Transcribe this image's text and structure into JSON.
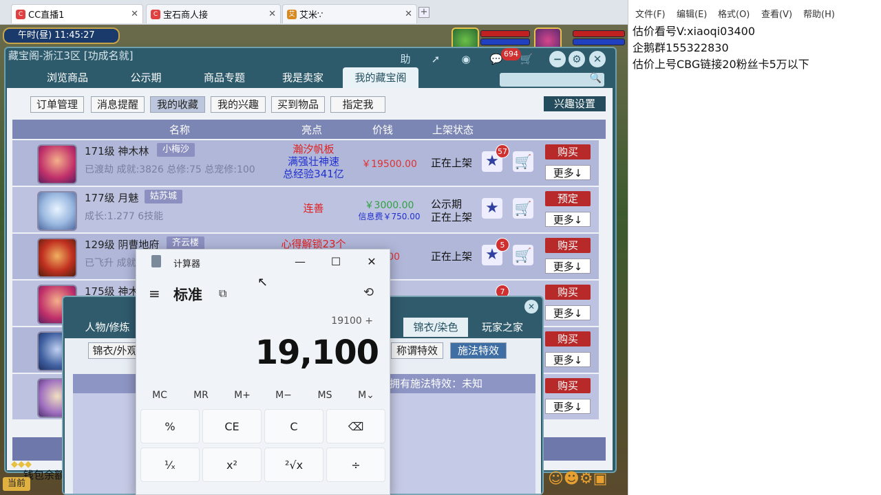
{
  "browser": {
    "tabs": [
      {
        "label": "CC直播1",
        "close": "✕"
      },
      {
        "label": "宝石商人接",
        "close": "✕"
      },
      {
        "label": "艾米∵",
        "close": "✕"
      }
    ],
    "new_tab": "+"
  },
  "game": {
    "time_label": "午时(昼)  11:45:27",
    "window_title": "藏宝阁-浙江3区 [功成名就]",
    "help_label": "助",
    "message_count": "694",
    "main_tabs": [
      "浏览商品",
      "公示期",
      "商品专题",
      "我是卖家",
      "我的藏宝阁"
    ],
    "sub_tabs": [
      "订单管理",
      "消息提醒",
      "我的收藏",
      "我的兴趣",
      "买到物品",
      "指定我"
    ],
    "interest_settings": "兴趣设置",
    "columns": [
      "名称",
      "亮点",
      "价钱",
      "上架状态"
    ],
    "rows": [
      {
        "level": "171级",
        "name": "神木林",
        "server": "小梅沙",
        "info": "已渡劫 成就:3826 总修:75 总宠修:100",
        "highlights": [
          "瀚汐帆板",
          "满强壮神速",
          "总经验341亿"
        ],
        "price": "￥19500.00",
        "fee": "",
        "status": "正在上架",
        "fav_count": "57",
        "buy": "购买",
        "more": "更多↓"
      },
      {
        "level": "177级",
        "name": "月魅",
        "server": "姑苏城",
        "info": "成长:1.277 6技能",
        "highlights": [
          "连善"
        ],
        "price": "￥3000.00",
        "fee": "信息费￥750.00",
        "status": "公示期\n正在上架",
        "fav_count": "",
        "buy": "预定",
        "more": "更多↓"
      },
      {
        "level": "129级",
        "name": "阴曹地府",
        "server": "齐云楼",
        "info": "已飞升 成就",
        "highlights": [
          "心得解锁23个"
        ],
        "price": "0.00",
        "fee": "",
        "status": "正在上架",
        "fav_count": "5",
        "buy": "购买",
        "more": "更多↓"
      },
      {
        "level": "175级",
        "name": "神木",
        "server": "",
        "info": "",
        "highlights": [],
        "price": "",
        "fee": "",
        "status": "",
        "fav_count": "7",
        "buy": "购买",
        "more": "更多↓"
      },
      {
        "level": "",
        "name": "",
        "server": "",
        "info": "",
        "highlights": [],
        "price": "",
        "fee": "",
        "status": "",
        "fav_count": "",
        "buy": "购买",
        "more": "更多↓"
      },
      {
        "level": "",
        "name": "",
        "server": "",
        "info": "",
        "highlights": [],
        "price": "",
        "fee": "",
        "status": "",
        "fav_count": "",
        "buy": "购买",
        "more": "更多↓"
      }
    ],
    "wallet_label": "钱包余额",
    "current_label": "当前"
  },
  "detail_window": {
    "tabs": [
      "人物/修炼",
      "锦衣/染色",
      "玩家之家"
    ],
    "buttons": [
      "锦衣/外观",
      "称谓特效",
      "施法特效"
    ],
    "panel_header": "拥有施法特效：未知"
  },
  "calculator": {
    "title": "计算器",
    "mode": "标准",
    "expression": "19100 +",
    "display": "19,100",
    "memory": [
      "MC",
      "MR",
      "M+",
      "M−",
      "MS",
      "M⌄"
    ],
    "keys_row1": [
      "%",
      "CE",
      "C",
      "⌫"
    ],
    "keys_row2": [
      "¹⁄ₓ",
      "x²",
      "²√x",
      "÷"
    ]
  },
  "notepad": {
    "menu": [
      "文件(F)",
      "编辑(E)",
      "格式(O)",
      "查看(V)",
      "帮助(H)"
    ],
    "lines": [
      "估价看号V:xiaoqi03400",
      "企鹅群155322830",
      "估价上号CBG链接20粉丝卡5万以下"
    ]
  }
}
